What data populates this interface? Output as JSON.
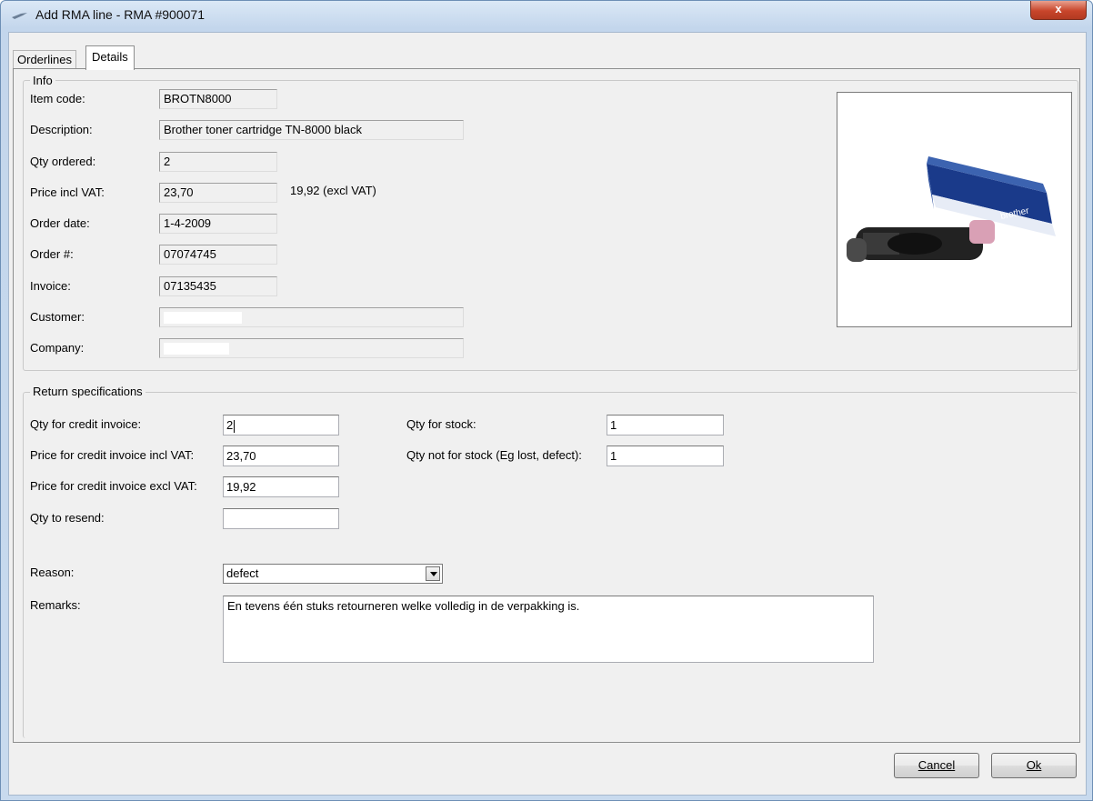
{
  "window": {
    "title": "Add RMA line - RMA #900071",
    "close_label": "x"
  },
  "tabs": [
    {
      "label": "Orderlines",
      "active": false
    },
    {
      "label": "Details",
      "active": true
    }
  ],
  "info": {
    "group_label": "Info",
    "item_code": {
      "label": "Item code:",
      "value": "BROTN8000"
    },
    "description": {
      "label": "Description:",
      "value": "Brother toner cartridge TN-8000 black"
    },
    "qty_ordered": {
      "label": "Qty ordered:",
      "value": "2"
    },
    "price_incl": {
      "label": "Price incl VAT:",
      "value": "23,70",
      "excl_text": "19,92  (excl VAT)"
    },
    "order_date": {
      "label": "Order date:",
      "value": "1-4-2009"
    },
    "order_no": {
      "label": "Order #:",
      "value": "07074745"
    },
    "invoice": {
      "label": "Invoice:",
      "value": "07135435"
    },
    "customer": {
      "label": "Customer:",
      "value": ""
    },
    "company": {
      "label": "Company:",
      "value": ""
    },
    "image_icon": "toner-cartridge-product-photo"
  },
  "returns": {
    "group_label": "Return specifications",
    "qty_credit": {
      "label": "Qty for credit invoice:",
      "value": "2"
    },
    "price_credit_incl": {
      "label": "Price for credit invoice incl VAT:",
      "value": "23,70"
    },
    "price_credit_excl": {
      "label": "Price for credit invoice excl VAT:",
      "value": "19,92"
    },
    "qty_resend": {
      "label": "Qty to resend:",
      "value": ""
    },
    "qty_stock": {
      "label": "Qty for stock:",
      "value": "1"
    },
    "qty_not_stock": {
      "label": "Qty not for stock (Eg lost, defect):",
      "value": "1"
    },
    "reason": {
      "label": "Reason:",
      "value": "defect"
    },
    "remarks": {
      "label": "Remarks:",
      "value": "En tevens één stuks retourneren welke volledig in de verpakking is."
    }
  },
  "buttons": {
    "cancel": "Cancel",
    "ok": "Ok"
  }
}
